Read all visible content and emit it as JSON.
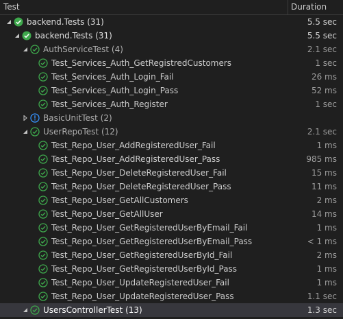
{
  "header": {
    "test_label": "Test",
    "duration_label": "Duration"
  },
  "colors": {
    "pass": "#3ea84c",
    "warning": "#3794ff",
    "selected_row": "#37373d"
  },
  "rows": [
    {
      "label": "backend.Tests (31)",
      "duration": "5.5 sec",
      "level": 0,
      "status": "pass",
      "expander": "expanded",
      "kind": "root"
    },
    {
      "label": "backend.Tests (31)",
      "duration": "5.5 sec",
      "level": 1,
      "status": "pass",
      "expander": "expanded",
      "kind": "root"
    },
    {
      "label": "AuthServiceTest (4)",
      "duration": "2.1 sec",
      "level": 2,
      "status": "pass",
      "expander": "expanded",
      "kind": "suite"
    },
    {
      "label": "Test_Services_Auth_GetRegistredCustomers",
      "duration": "1 sec",
      "level": 3,
      "status": "pass",
      "expander": "none",
      "kind": "test"
    },
    {
      "label": "Test_Services_Auth_Login_Fail",
      "duration": "26 ms",
      "level": 3,
      "status": "pass",
      "expander": "none",
      "kind": "test"
    },
    {
      "label": "Test_Services_Auth_Login_Pass",
      "duration": "52 ms",
      "level": 3,
      "status": "pass",
      "expander": "none",
      "kind": "test"
    },
    {
      "label": "Test_Services_Auth_Register",
      "duration": "1 sec",
      "level": 3,
      "status": "pass",
      "expander": "none",
      "kind": "test"
    },
    {
      "label": "BasicUnitTest (2)",
      "duration": "",
      "level": 2,
      "status": "warning",
      "expander": "collapsed",
      "kind": "suite"
    },
    {
      "label": "UserRepoTest (12)",
      "duration": "2.1 sec",
      "level": 2,
      "status": "pass",
      "expander": "expanded",
      "kind": "suite"
    },
    {
      "label": "Test_Repo_User_AddRegisteredUser_Fail",
      "duration": "1 ms",
      "level": 3,
      "status": "pass",
      "expander": "none",
      "kind": "test"
    },
    {
      "label": "Test_Repo_User_AddRegisteredUser_Pass",
      "duration": "985 ms",
      "level": 3,
      "status": "pass",
      "expander": "none",
      "kind": "test"
    },
    {
      "label": "Test_Repo_User_DeleteRegisteredUser_Fail",
      "duration": "15 ms",
      "level": 3,
      "status": "pass",
      "expander": "none",
      "kind": "test"
    },
    {
      "label": "Test_Repo_User_DeleteRegisteredUser_Pass",
      "duration": "11 ms",
      "level": 3,
      "status": "pass",
      "expander": "none",
      "kind": "test"
    },
    {
      "label": "Test_Repo_User_GetAllCustomers",
      "duration": "2 ms",
      "level": 3,
      "status": "pass",
      "expander": "none",
      "kind": "test"
    },
    {
      "label": "Test_Repo_User_GetAllUser",
      "duration": "14 ms",
      "level": 3,
      "status": "pass",
      "expander": "none",
      "kind": "test"
    },
    {
      "label": "Test_Repo_User_GetRegisteredUserByEmail_Fail",
      "duration": "1 ms",
      "level": 3,
      "status": "pass",
      "expander": "none",
      "kind": "test"
    },
    {
      "label": "Test_Repo_User_GetRegisteredUserByEmail_Pass",
      "duration": "< 1 ms",
      "level": 3,
      "status": "pass",
      "expander": "none",
      "kind": "test"
    },
    {
      "label": "Test_Repo_User_GetRegisteredUserById_Fail",
      "duration": "2 ms",
      "level": 3,
      "status": "pass",
      "expander": "none",
      "kind": "test"
    },
    {
      "label": "Test_Repo_User_GetRegisteredUserById_Pass",
      "duration": "1 ms",
      "level": 3,
      "status": "pass",
      "expander": "none",
      "kind": "test"
    },
    {
      "label": "Test_Repo_User_UpdateRegisteredUser_Fail",
      "duration": "1 ms",
      "level": 3,
      "status": "pass",
      "expander": "none",
      "kind": "test"
    },
    {
      "label": "Test_Repo_User_UpdateRegisteredUser_Pass",
      "duration": "1.1 sec",
      "level": 3,
      "status": "pass",
      "expander": "none",
      "kind": "test"
    },
    {
      "label": "UsersControllerTest (13)",
      "duration": "1.3 sec",
      "level": 2,
      "status": "pass",
      "expander": "expanded",
      "kind": "suite-selected"
    }
  ]
}
